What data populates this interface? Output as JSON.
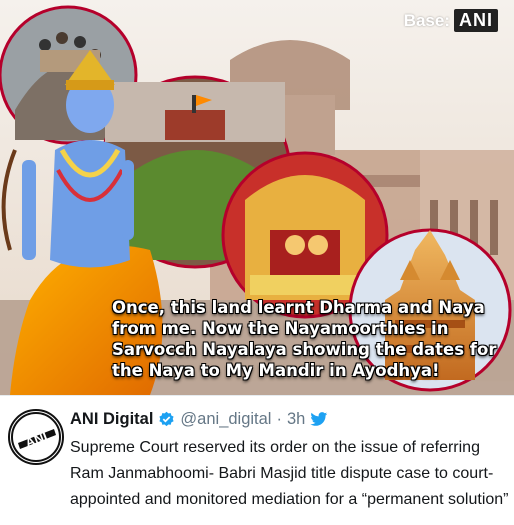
{
  "image": {
    "watermark_prefix": "Base:",
    "watermark_brand": "ANI",
    "caption": "Once, this land learnt Dharma and Naya from me. Now the Nayamoorthies in Sarvocch Nayalaya showing the dates for the Naya to My Mandir in Ayodhya!"
  },
  "tweet": {
    "display_name": "ANI Digital",
    "handle": "@ani_digital",
    "separator": "·",
    "time": "3h",
    "text": "Supreme Court reserved its order on the  issue of referring\nRam Janmabhoomi- Babri Masjid title dispute case to court-\nappointed and monitored mediation for a “permanent solution”",
    "avatar_text": "ANI"
  },
  "colors": {
    "verified": "#1da1f2",
    "bird": "#1da1f2",
    "circle_border": "#b5002b"
  }
}
